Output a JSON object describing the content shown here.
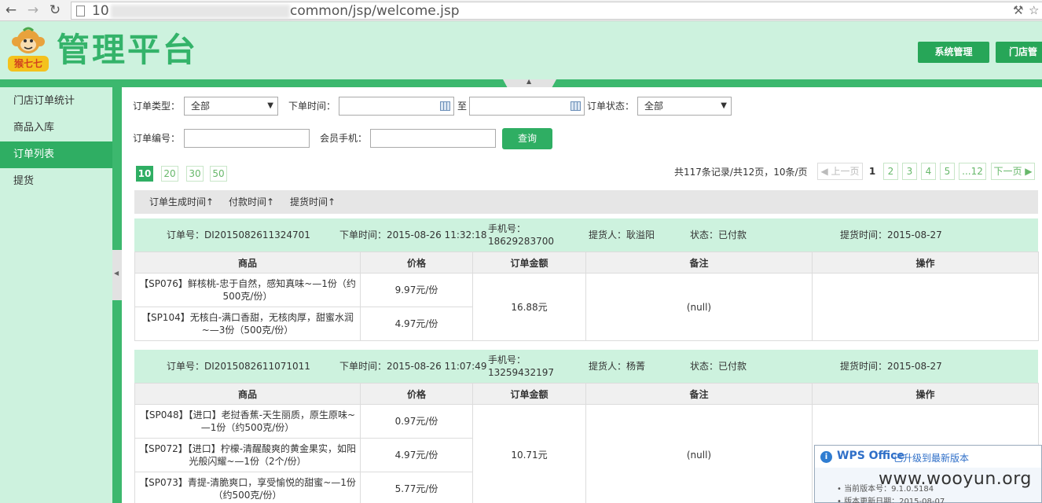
{
  "browser": {
    "url_prefix": "10",
    "url_suffix": "common/jsp/welcome.jsp"
  },
  "header": {
    "logo_text": "猴七七",
    "brand": "管理平台",
    "buttons": [
      "系统管理",
      "门店管"
    ]
  },
  "sidebar": {
    "items": [
      "门店订单统计",
      "商品入库",
      "订单列表",
      "提货"
    ],
    "active_index": 2
  },
  "filters": {
    "order_type_label": "订单类型：",
    "order_type_value": "全部",
    "order_time_label": "下单时间：",
    "to_label": "至",
    "order_status_label": "订单状态：",
    "order_status_value": "全部",
    "order_no_label": "订单编号：",
    "member_phone_label": "会员手机：",
    "query_button": "查询"
  },
  "page_sizes": [
    "10",
    "20",
    "30",
    "50"
  ],
  "page_size_active": "10",
  "pagination": {
    "info": "共117条记录/共12页，10条/页",
    "prev": "上一页",
    "pages": [
      "1",
      "2",
      "3",
      "4",
      "5",
      "...12"
    ],
    "current": "1",
    "next": "下一页"
  },
  "sort_fields": [
    "订单生成时间↑",
    "付款时间↑",
    "提货时间↑"
  ],
  "table_headers": [
    "商品",
    "价格",
    "订单金额",
    "备注",
    "操作"
  ],
  "orders": [
    {
      "order_no": "订单号：DI2015082611324701",
      "order_time": "下单时间：2015-08-26 11:32:18",
      "phone_label": "手机号：",
      "phone": "18629283700",
      "picker": "提货人：耿溢阳",
      "status": "状态：已付款",
      "pickup_time": "提货时间：2015-08-27",
      "items": [
        {
          "goods": "【SP076】鲜核桃-忠于自然，感知真味~—1份（约500克/份）",
          "price": "9.97元/份"
        },
        {
          "goods": "【SP104】无核白-满口香甜，无核肉厚，甜蜜水润~—3份（500克/份）",
          "price": "4.97元/份"
        }
      ],
      "amount": "16.88元",
      "remark": "(null)"
    },
    {
      "order_no": "订单号：DI2015082611071011",
      "order_time": "下单时间：2015-08-26 11:07:49",
      "phone_label": "手机号：",
      "phone": "13259432197",
      "picker": "提货人：杨菁",
      "status": "状态：已付款",
      "pickup_time": "提货时间：2015-08-27",
      "items": [
        {
          "goods": "【SP048】【进口】老挝香蕉-天生丽质，原生原味~—1份（约500克/份）",
          "price": "0.97元/份"
        },
        {
          "goods": "【SP072】【进口】柠檬-清醒酸爽的黄金果实，如阳光般闪耀~—1份（2个/份）",
          "price": "4.97元/份"
        },
        {
          "goods": "【SP073】青提-清脆爽口，享受愉悦的甜蜜~—1份（约500克/份）",
          "price": "5.77元/份"
        }
      ],
      "amount": "10.71元",
      "remark": "(null)"
    }
  ],
  "wps_popup": {
    "brand": "WPS Office",
    "message": "已升级到最新版本",
    "line1": "• 当前版本号：9.1.0.5184",
    "line2": "• 版本更新日期：2015-08-07"
  },
  "watermark": "www.wooyun.org",
  "colors": {
    "accent": "#2fae63",
    "header_bg": "#cdf2de",
    "order_head_bg": "#cdf2de"
  }
}
